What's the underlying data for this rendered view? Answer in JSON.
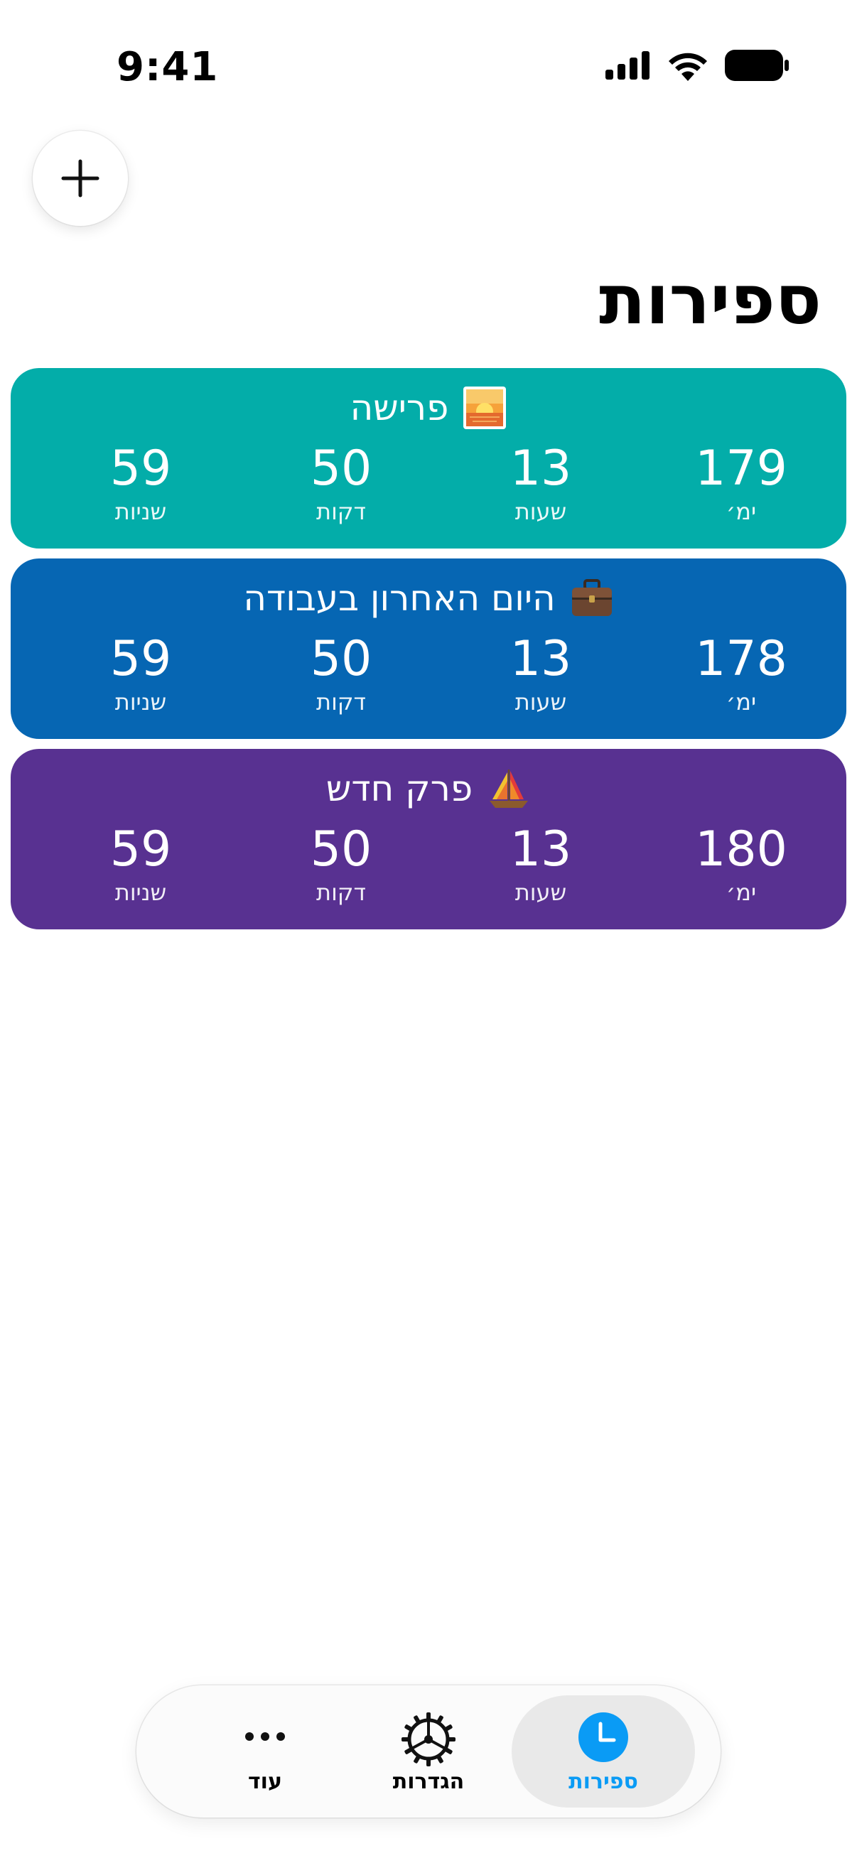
{
  "status_bar": {
    "time": "9:41"
  },
  "page_title": "ספירות",
  "add_button": {
    "icon": "plus-icon"
  },
  "cards": [
    {
      "title": "פרישה",
      "emoji": "sunrise-icon",
      "color": "#03ADA9",
      "units": [
        {
          "value": "179",
          "label": "ימ׳"
        },
        {
          "value": "13",
          "label": "שעות"
        },
        {
          "value": "50",
          "label": "דקות"
        },
        {
          "value": "59",
          "label": "שניות"
        }
      ]
    },
    {
      "title": "היום האחרון בעבודה",
      "emoji": "briefcase-icon",
      "color": "#0666B3",
      "units": [
        {
          "value": "178",
          "label": "ימ׳"
        },
        {
          "value": "13",
          "label": "שעות"
        },
        {
          "value": "50",
          "label": "דקות"
        },
        {
          "value": "59",
          "label": "שניות"
        }
      ]
    },
    {
      "title": "פרק חדש",
      "emoji": "sailboat-icon",
      "color": "#583191",
      "units": [
        {
          "value": "180",
          "label": "ימ׳"
        },
        {
          "value": "13",
          "label": "שעות"
        },
        {
          "value": "50",
          "label": "דקות"
        },
        {
          "value": "59",
          "label": "שניות"
        }
      ]
    }
  ],
  "tab_bar": {
    "tabs": [
      {
        "label": "ספירות",
        "icon": "clock-icon",
        "active": true
      },
      {
        "label": "הגדרות",
        "icon": "gear-icon",
        "active": false
      },
      {
        "label": "עוד",
        "icon": "more-icon",
        "active": false
      }
    ],
    "accent_color": "#0A9BF5"
  }
}
